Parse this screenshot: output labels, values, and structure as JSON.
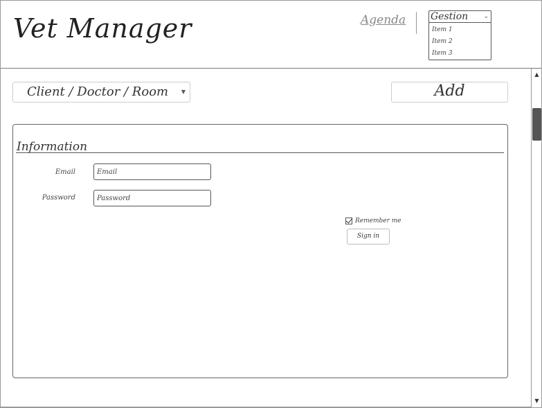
{
  "header": {
    "app_title": "Vet Manager",
    "nav_agenda": "Agenda",
    "nav_gestion": "Gestion",
    "gestion_menu": [
      "Item 1",
      "Item 2",
      "Item 3"
    ]
  },
  "toolbar": {
    "entity_select_value": "Client / Doctor / Room",
    "add_label": "Add"
  },
  "panel": {
    "title": "Information",
    "email_label": "Email",
    "email_placeholder": "Email",
    "password_label": "Password",
    "password_placeholder": "Password",
    "remember_label": "Remember me",
    "remember_checked": true,
    "signin_label": "Sign in"
  },
  "icons": {
    "dropdown": "chevron-down-icon",
    "check": "check-icon",
    "scroll_up": "arrow-up-icon",
    "scroll_down": "arrow-down-icon"
  }
}
